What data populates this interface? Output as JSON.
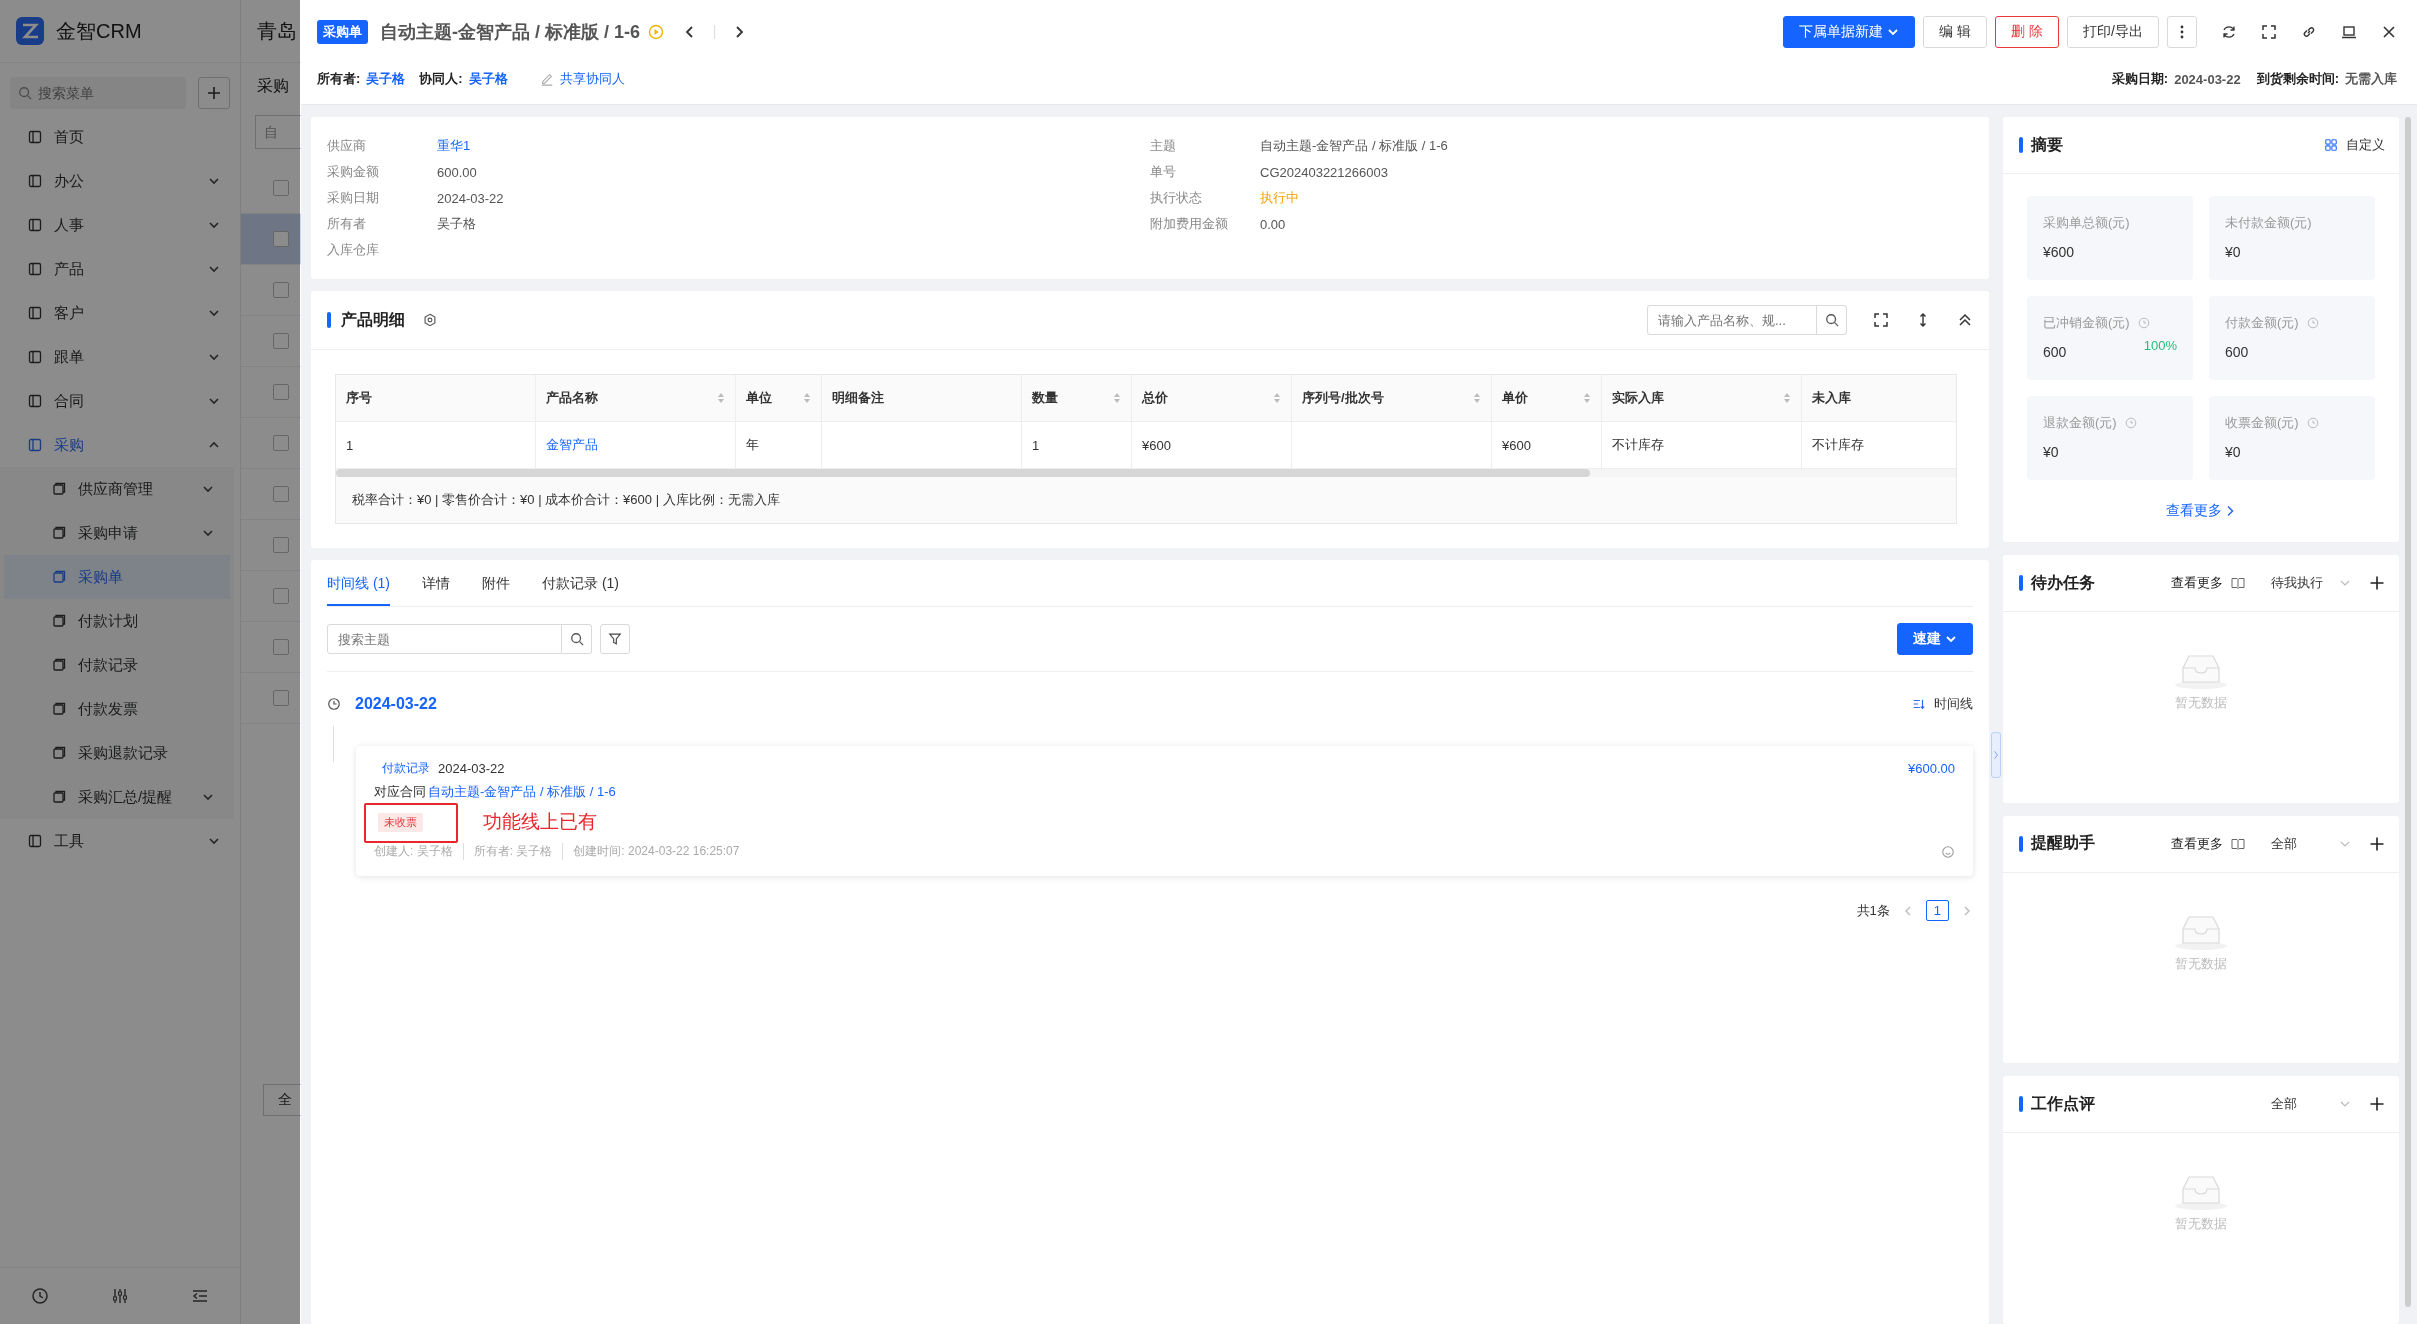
{
  "app": {
    "logo": "金智CRM",
    "search_placeholder": "搜索菜单",
    "menu": [
      {
        "label": "首页",
        "kind": "link",
        "selected": false
      },
      {
        "label": "办公",
        "kind": "group",
        "expanded": false,
        "selected": false
      },
      {
        "label": "人事",
        "kind": "group",
        "expanded": false,
        "selected": false
      },
      {
        "label": "产品",
        "kind": "group",
        "expanded": false,
        "selected": false
      },
      {
        "label": "客户",
        "kind": "group",
        "expanded": false,
        "selected": false
      },
      {
        "label": "跟单",
        "kind": "group",
        "expanded": false,
        "selected": false
      },
      {
        "label": "合同",
        "kind": "group",
        "expanded": false,
        "selected": false
      },
      {
        "label": "采购",
        "kind": "group",
        "expanded": true,
        "selected": true,
        "children": [
          {
            "label": "供应商管理",
            "kind": "group",
            "expanded": false,
            "selected": false
          },
          {
            "label": "采购申请",
            "kind": "group",
            "expanded": false,
            "selected": false
          },
          {
            "label": "采购单",
            "kind": "link",
            "selected": true
          },
          {
            "label": "付款计划",
            "kind": "link",
            "selected": false
          },
          {
            "label": "付款记录",
            "kind": "link",
            "selected": false
          },
          {
            "label": "付款发票",
            "kind": "link",
            "selected": false
          },
          {
            "label": "采购退款记录",
            "kind": "link",
            "selected": false
          },
          {
            "label": "采购汇总/提醒",
            "kind": "group",
            "expanded": false,
            "selected": false
          }
        ]
      },
      {
        "label": "工具",
        "kind": "group",
        "expanded": false,
        "selected": false
      }
    ]
  },
  "background": {
    "title": "青岛",
    "tab": "采购",
    "filter": "自",
    "button": "全",
    "rows": [
      {
        "checked": false,
        "selected": false
      },
      {
        "checked": false,
        "selected": true
      },
      {
        "checked": false,
        "selected": false
      },
      {
        "checked": false,
        "selected": false
      },
      {
        "checked": false,
        "selected": false
      },
      {
        "checked": false,
        "selected": false
      },
      {
        "checked": false,
        "selected": false
      },
      {
        "checked": false,
        "selected": false
      },
      {
        "checked": false,
        "selected": false
      },
      {
        "checked": false,
        "selected": false
      },
      {
        "checked": false,
        "selected": false
      }
    ]
  },
  "drawer": {
    "badge": "采购单",
    "title": "自动主题-金智产品 / 标准版 / 1-6",
    "owner_label": "所有者:",
    "owner": "吴子格",
    "collaborator_label": "协同人:",
    "collaborator": "吴子格",
    "share": "共享协同人",
    "buttons": [
      {
        "label": "下属单据新建",
        "kind": "primary"
      },
      {
        "label": "编 辑",
        "kind": "default"
      },
      {
        "label": "删 除",
        "kind": "danger"
      },
      {
        "label": "打印/导出",
        "kind": "default"
      }
    ],
    "meta": [
      {
        "label": "采购日期:",
        "value": "2024-03-22"
      },
      {
        "label": "到货剩余时间:",
        "value": "无需入库"
      }
    ],
    "details_left": [
      {
        "label": "供应商",
        "value": "重华1",
        "kind": "link"
      },
      {
        "label": "采购金额",
        "value": "600.00",
        "kind": "text"
      },
      {
        "label": "采购日期",
        "value": "2024-03-22",
        "kind": "text"
      },
      {
        "label": "所有者",
        "value": "吴子格",
        "kind": "text"
      },
      {
        "label": "入库仓库"
      }
    ],
    "details_right": [
      {
        "label": "主题",
        "value": "自动主题-金智产品 / 标准版 / 1-6",
        "kind": "text"
      },
      {
        "label": "单号",
        "value": "CG202403221266003",
        "kind": "text"
      },
      {
        "label": "执行状态",
        "value": "执行中",
        "kind": "status"
      },
      {
        "label": "附加费用金额",
        "value": "0.00",
        "kind": "text"
      }
    ],
    "products": {
      "title": "产品明细",
      "search_placeholder": "请输入产品名称、规...",
      "columns": [
        {
          "label": "序号",
          "sortable": false
        },
        {
          "label": "产品名称",
          "sortable": true
        },
        {
          "label": "单位",
          "sortable": true
        },
        {
          "label": "明细备注",
          "sortable": false
        },
        {
          "label": "数量",
          "sortable": true
        },
        {
          "label": "总价",
          "sortable": true
        },
        {
          "label": "序列号/批次号",
          "sortable": true
        },
        {
          "label": "单价",
          "sortable": true
        },
        {
          "label": "实际入库",
          "sortable": true
        },
        {
          "label": "未入库"
        }
      ],
      "rows": [
        [
          {
            "text": "1",
            "kind": "text"
          },
          {
            "text": "金智产品",
            "kind": "link"
          },
          {
            "text": "年",
            "kind": "text"
          },
          {},
          {
            "text": "1",
            "kind": "text"
          },
          {
            "text": "¥600",
            "kind": "text"
          },
          {},
          {
            "text": "¥600",
            "kind": "text"
          },
          {
            "text": "不计库存",
            "kind": "text"
          },
          {
            "text": "不计库存",
            "kind": "text"
          }
        ]
      ],
      "summary": "税率合计：¥0 |  零售价合计：¥0 |  成本价合计：¥600 |  入库比例：无需入库"
    },
    "tabs": [
      {
        "label": "时间线 (1)",
        "selected": true
      },
      {
        "label": "详情",
        "selected": false
      },
      {
        "label": "附件",
        "selected": false
      },
      {
        "label": "付款记录 (1)",
        "selected": false
      }
    ],
    "timeline_search_placeholder": "搜索主题",
    "quick_create": "速建",
    "sort_label": "时间线",
    "timeline": [
      {
        "date": "2024-03-22",
        "entries": [
          {
            "type": "付款记录",
            "date": "2024-03-22",
            "amount": "¥600.00",
            "contract_label": "对应合同",
            "contract": "自动主题-金智产品 / 标准版 / 1-6",
            "tag": "未收票",
            "meta": [
              "创建人: 吴子格",
              "所有者: 吴子格",
              "创建时间: 2024-03-22 16:25:07"
            ]
          }
        ]
      }
    ],
    "annotation": "功能线上已有",
    "pagination": {
      "total": "共1条",
      "pages": [
        {
          "label": "1",
          "selected": true
        }
      ]
    },
    "side": {
      "summary_title": "摘要",
      "customize": "自定义",
      "stats": [
        {
          "label": "采购单总额(元)",
          "value": "¥600",
          "info": false
        },
        {
          "label": "未付款金额(元)",
          "value": "¥0",
          "info": false
        },
        {
          "label": "已冲销金额(元)",
          "value": "600",
          "info": true,
          "percent": "100%"
        },
        {
          "label": "付款金额(元)",
          "value": "600",
          "info": true
        },
        {
          "label": "退款金额(元)",
          "value": "¥0",
          "info": true
        },
        {
          "label": "收票金额(元)",
          "value": "¥0",
          "info": true
        }
      ],
      "more": "查看更多",
      "panels": [
        {
          "title": "待办任务",
          "more": "查看更多",
          "filter": "待我执行",
          "empty": "暂无数据"
        },
        {
          "title": "提醒助手",
          "more": "查看更多",
          "filter": "全部",
          "empty": "暂无数据"
        },
        {
          "title": "工作点评",
          "filter": "全部",
          "empty": "暂无数据"
        }
      ]
    }
  }
}
